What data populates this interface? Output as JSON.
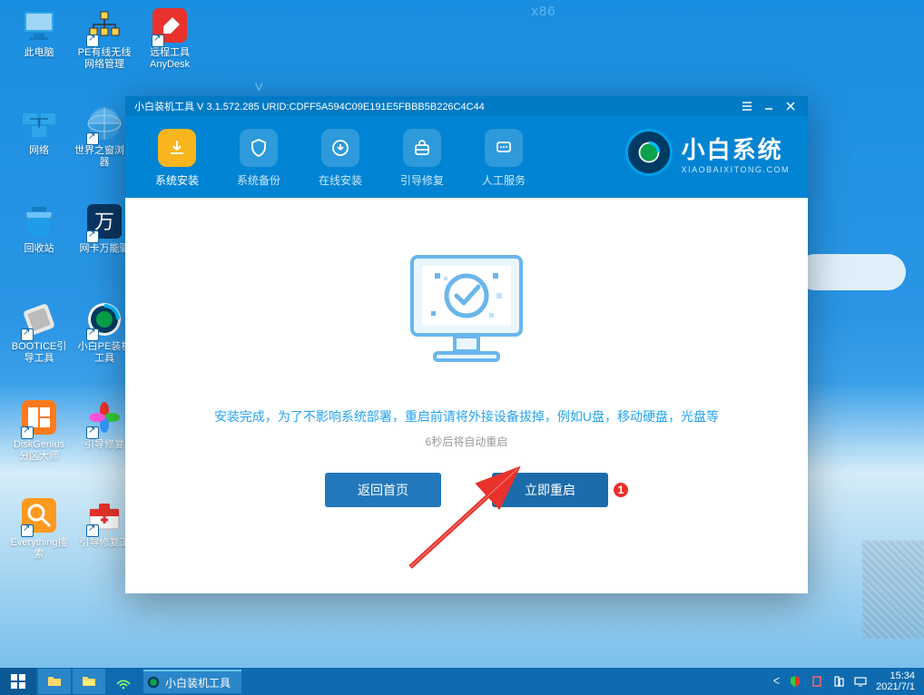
{
  "arch_label": "x86",
  "desktop_icons": [
    {
      "label": "此电脑",
      "col": 0,
      "row": 0
    },
    {
      "label": "PE有线无线网络管理",
      "col": 1,
      "row": 0
    },
    {
      "label": "远程工具AnyDesk",
      "col": 2,
      "row": 0
    },
    {
      "label": "网络",
      "col": 0,
      "row": 1
    },
    {
      "label": "世界之窗浏览器",
      "col": 1,
      "row": 1
    },
    {
      "label": "回收站",
      "col": 0,
      "row": 2
    },
    {
      "label": "网卡万能驱",
      "col": 1,
      "row": 2
    },
    {
      "label": "BOOTICE引导工具",
      "col": 0,
      "row": 3
    },
    {
      "label": "小白PE装机工具",
      "col": 1,
      "row": 3
    },
    {
      "label": "DiskGenius分区大师",
      "col": 0,
      "row": 4
    },
    {
      "label": "引导修复",
      "col": 1,
      "row": 4
    },
    {
      "label": "Everything搜索",
      "col": 0,
      "row": 5
    },
    {
      "label": "引导修复工",
      "col": 1,
      "row": 5
    }
  ],
  "window": {
    "title": "小白装机工具 V 3.1.572.285 URID:CDFF5A594C09E191E5FBBB5B226C4C44",
    "ribbon": [
      {
        "label": "系统安装",
        "active": true,
        "icon": "download"
      },
      {
        "label": "系统备份",
        "active": false,
        "icon": "shield"
      },
      {
        "label": "在线安装",
        "active": false,
        "icon": "download-circle"
      },
      {
        "label": "引导修复",
        "active": false,
        "icon": "toolbox"
      },
      {
        "label": "人工服务",
        "active": false,
        "icon": "chat"
      }
    ],
    "brand_name": "小白系统",
    "brand_sub": "XIAOBAIXITONG.COM",
    "main_message": "安装完成，为了不影响系统部署，重启前请将外接设备拔掉，例如U盘，移动硬盘，光盘等",
    "sub_message": "6秒后将自动重启",
    "btn_back": "返回首页",
    "btn_restart": "立即重启",
    "callout": "1"
  },
  "taskbar": {
    "app_label": "小白装机工具",
    "time": "15:34",
    "date": "2021/7/1"
  }
}
